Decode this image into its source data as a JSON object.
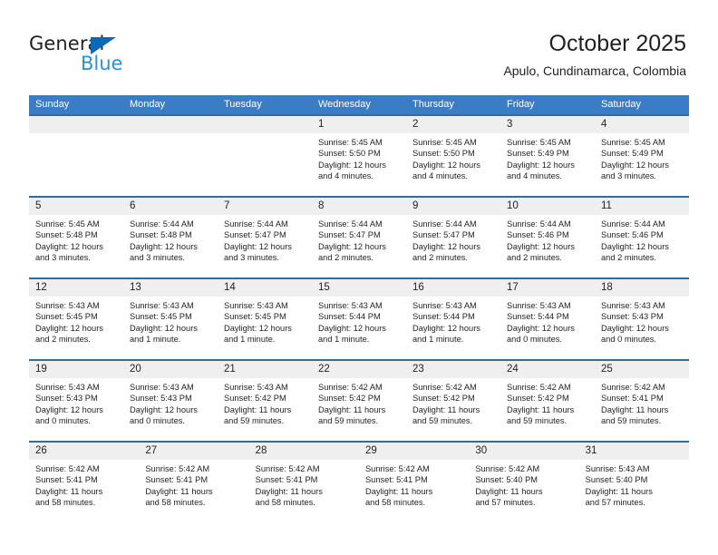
{
  "brand": {
    "name_part1": "General",
    "name_part2": "Blue",
    "accent_color": "#0b69b5",
    "secondary_color": "#2f8fd8"
  },
  "header": {
    "title": "October 2025",
    "subtitle": "Apulo, Cundinamarca, Colombia"
  },
  "theme": {
    "header_row_bg": "#3b7dc4",
    "cell_top_border": "#2e6da4",
    "day_number_bg": "#efefef",
    "text_color": "#231f20"
  },
  "weekdays": [
    "Sunday",
    "Monday",
    "Tuesday",
    "Wednesday",
    "Thursday",
    "Friday",
    "Saturday"
  ],
  "weeks": [
    [
      {
        "day": "",
        "sunrise": "",
        "sunset": "",
        "daylight_line1": "",
        "daylight_line2": ""
      },
      {
        "day": "",
        "sunrise": "",
        "sunset": "",
        "daylight_line1": "",
        "daylight_line2": ""
      },
      {
        "day": "",
        "sunrise": "",
        "sunset": "",
        "daylight_line1": "",
        "daylight_line2": ""
      },
      {
        "day": "1",
        "sunrise": "Sunrise: 5:45 AM",
        "sunset": "Sunset: 5:50 PM",
        "daylight_line1": "Daylight: 12 hours",
        "daylight_line2": "and 4 minutes."
      },
      {
        "day": "2",
        "sunrise": "Sunrise: 5:45 AM",
        "sunset": "Sunset: 5:50 PM",
        "daylight_line1": "Daylight: 12 hours",
        "daylight_line2": "and 4 minutes."
      },
      {
        "day": "3",
        "sunrise": "Sunrise: 5:45 AM",
        "sunset": "Sunset: 5:49 PM",
        "daylight_line1": "Daylight: 12 hours",
        "daylight_line2": "and 4 minutes."
      },
      {
        "day": "4",
        "sunrise": "Sunrise: 5:45 AM",
        "sunset": "Sunset: 5:49 PM",
        "daylight_line1": "Daylight: 12 hours",
        "daylight_line2": "and 3 minutes."
      }
    ],
    [
      {
        "day": "5",
        "sunrise": "Sunrise: 5:45 AM",
        "sunset": "Sunset: 5:48 PM",
        "daylight_line1": "Daylight: 12 hours",
        "daylight_line2": "and 3 minutes."
      },
      {
        "day": "6",
        "sunrise": "Sunrise: 5:44 AM",
        "sunset": "Sunset: 5:48 PM",
        "daylight_line1": "Daylight: 12 hours",
        "daylight_line2": "and 3 minutes."
      },
      {
        "day": "7",
        "sunrise": "Sunrise: 5:44 AM",
        "sunset": "Sunset: 5:47 PM",
        "daylight_line1": "Daylight: 12 hours",
        "daylight_line2": "and 3 minutes."
      },
      {
        "day": "8",
        "sunrise": "Sunrise: 5:44 AM",
        "sunset": "Sunset: 5:47 PM",
        "daylight_line1": "Daylight: 12 hours",
        "daylight_line2": "and 2 minutes."
      },
      {
        "day": "9",
        "sunrise": "Sunrise: 5:44 AM",
        "sunset": "Sunset: 5:47 PM",
        "daylight_line1": "Daylight: 12 hours",
        "daylight_line2": "and 2 minutes."
      },
      {
        "day": "10",
        "sunrise": "Sunrise: 5:44 AM",
        "sunset": "Sunset: 5:46 PM",
        "daylight_line1": "Daylight: 12 hours",
        "daylight_line2": "and 2 minutes."
      },
      {
        "day": "11",
        "sunrise": "Sunrise: 5:44 AM",
        "sunset": "Sunset: 5:46 PM",
        "daylight_line1": "Daylight: 12 hours",
        "daylight_line2": "and 2 minutes."
      }
    ],
    [
      {
        "day": "12",
        "sunrise": "Sunrise: 5:43 AM",
        "sunset": "Sunset: 5:45 PM",
        "daylight_line1": "Daylight: 12 hours",
        "daylight_line2": "and 2 minutes."
      },
      {
        "day": "13",
        "sunrise": "Sunrise: 5:43 AM",
        "sunset": "Sunset: 5:45 PM",
        "daylight_line1": "Daylight: 12 hours",
        "daylight_line2": "and 1 minute."
      },
      {
        "day": "14",
        "sunrise": "Sunrise: 5:43 AM",
        "sunset": "Sunset: 5:45 PM",
        "daylight_line1": "Daylight: 12 hours",
        "daylight_line2": "and 1 minute."
      },
      {
        "day": "15",
        "sunrise": "Sunrise: 5:43 AM",
        "sunset": "Sunset: 5:44 PM",
        "daylight_line1": "Daylight: 12 hours",
        "daylight_line2": "and 1 minute."
      },
      {
        "day": "16",
        "sunrise": "Sunrise: 5:43 AM",
        "sunset": "Sunset: 5:44 PM",
        "daylight_line1": "Daylight: 12 hours",
        "daylight_line2": "and 1 minute."
      },
      {
        "day": "17",
        "sunrise": "Sunrise: 5:43 AM",
        "sunset": "Sunset: 5:44 PM",
        "daylight_line1": "Daylight: 12 hours",
        "daylight_line2": "and 0 minutes."
      },
      {
        "day": "18",
        "sunrise": "Sunrise: 5:43 AM",
        "sunset": "Sunset: 5:43 PM",
        "daylight_line1": "Daylight: 12 hours",
        "daylight_line2": "and 0 minutes."
      }
    ],
    [
      {
        "day": "19",
        "sunrise": "Sunrise: 5:43 AM",
        "sunset": "Sunset: 5:43 PM",
        "daylight_line1": "Daylight: 12 hours",
        "daylight_line2": "and 0 minutes."
      },
      {
        "day": "20",
        "sunrise": "Sunrise: 5:43 AM",
        "sunset": "Sunset: 5:43 PM",
        "daylight_line1": "Daylight: 12 hours",
        "daylight_line2": "and 0 minutes."
      },
      {
        "day": "21",
        "sunrise": "Sunrise: 5:43 AM",
        "sunset": "Sunset: 5:42 PM",
        "daylight_line1": "Daylight: 11 hours",
        "daylight_line2": "and 59 minutes."
      },
      {
        "day": "22",
        "sunrise": "Sunrise: 5:42 AM",
        "sunset": "Sunset: 5:42 PM",
        "daylight_line1": "Daylight: 11 hours",
        "daylight_line2": "and 59 minutes."
      },
      {
        "day": "23",
        "sunrise": "Sunrise: 5:42 AM",
        "sunset": "Sunset: 5:42 PM",
        "daylight_line1": "Daylight: 11 hours",
        "daylight_line2": "and 59 minutes."
      },
      {
        "day": "24",
        "sunrise": "Sunrise: 5:42 AM",
        "sunset": "Sunset: 5:42 PM",
        "daylight_line1": "Daylight: 11 hours",
        "daylight_line2": "and 59 minutes."
      },
      {
        "day": "25",
        "sunrise": "Sunrise: 5:42 AM",
        "sunset": "Sunset: 5:41 PM",
        "daylight_line1": "Daylight: 11 hours",
        "daylight_line2": "and 59 minutes."
      }
    ],
    [
      {
        "day": "26",
        "sunrise": "Sunrise: 5:42 AM",
        "sunset": "Sunset: 5:41 PM",
        "daylight_line1": "Daylight: 11 hours",
        "daylight_line2": "and 58 minutes."
      },
      {
        "day": "27",
        "sunrise": "Sunrise: 5:42 AM",
        "sunset": "Sunset: 5:41 PM",
        "daylight_line1": "Daylight: 11 hours",
        "daylight_line2": "and 58 minutes."
      },
      {
        "day": "28",
        "sunrise": "Sunrise: 5:42 AM",
        "sunset": "Sunset: 5:41 PM",
        "daylight_line1": "Daylight: 11 hours",
        "daylight_line2": "and 58 minutes."
      },
      {
        "day": "29",
        "sunrise": "Sunrise: 5:42 AM",
        "sunset": "Sunset: 5:41 PM",
        "daylight_line1": "Daylight: 11 hours",
        "daylight_line2": "and 58 minutes."
      },
      {
        "day": "30",
        "sunrise": "Sunrise: 5:42 AM",
        "sunset": "Sunset: 5:40 PM",
        "daylight_line1": "Daylight: 11 hours",
        "daylight_line2": "and 57 minutes."
      },
      {
        "day": "31",
        "sunrise": "Sunrise: 5:43 AM",
        "sunset": "Sunset: 5:40 PM",
        "daylight_line1": "Daylight: 11 hours",
        "daylight_line2": "and 57 minutes."
      }
    ]
  ]
}
